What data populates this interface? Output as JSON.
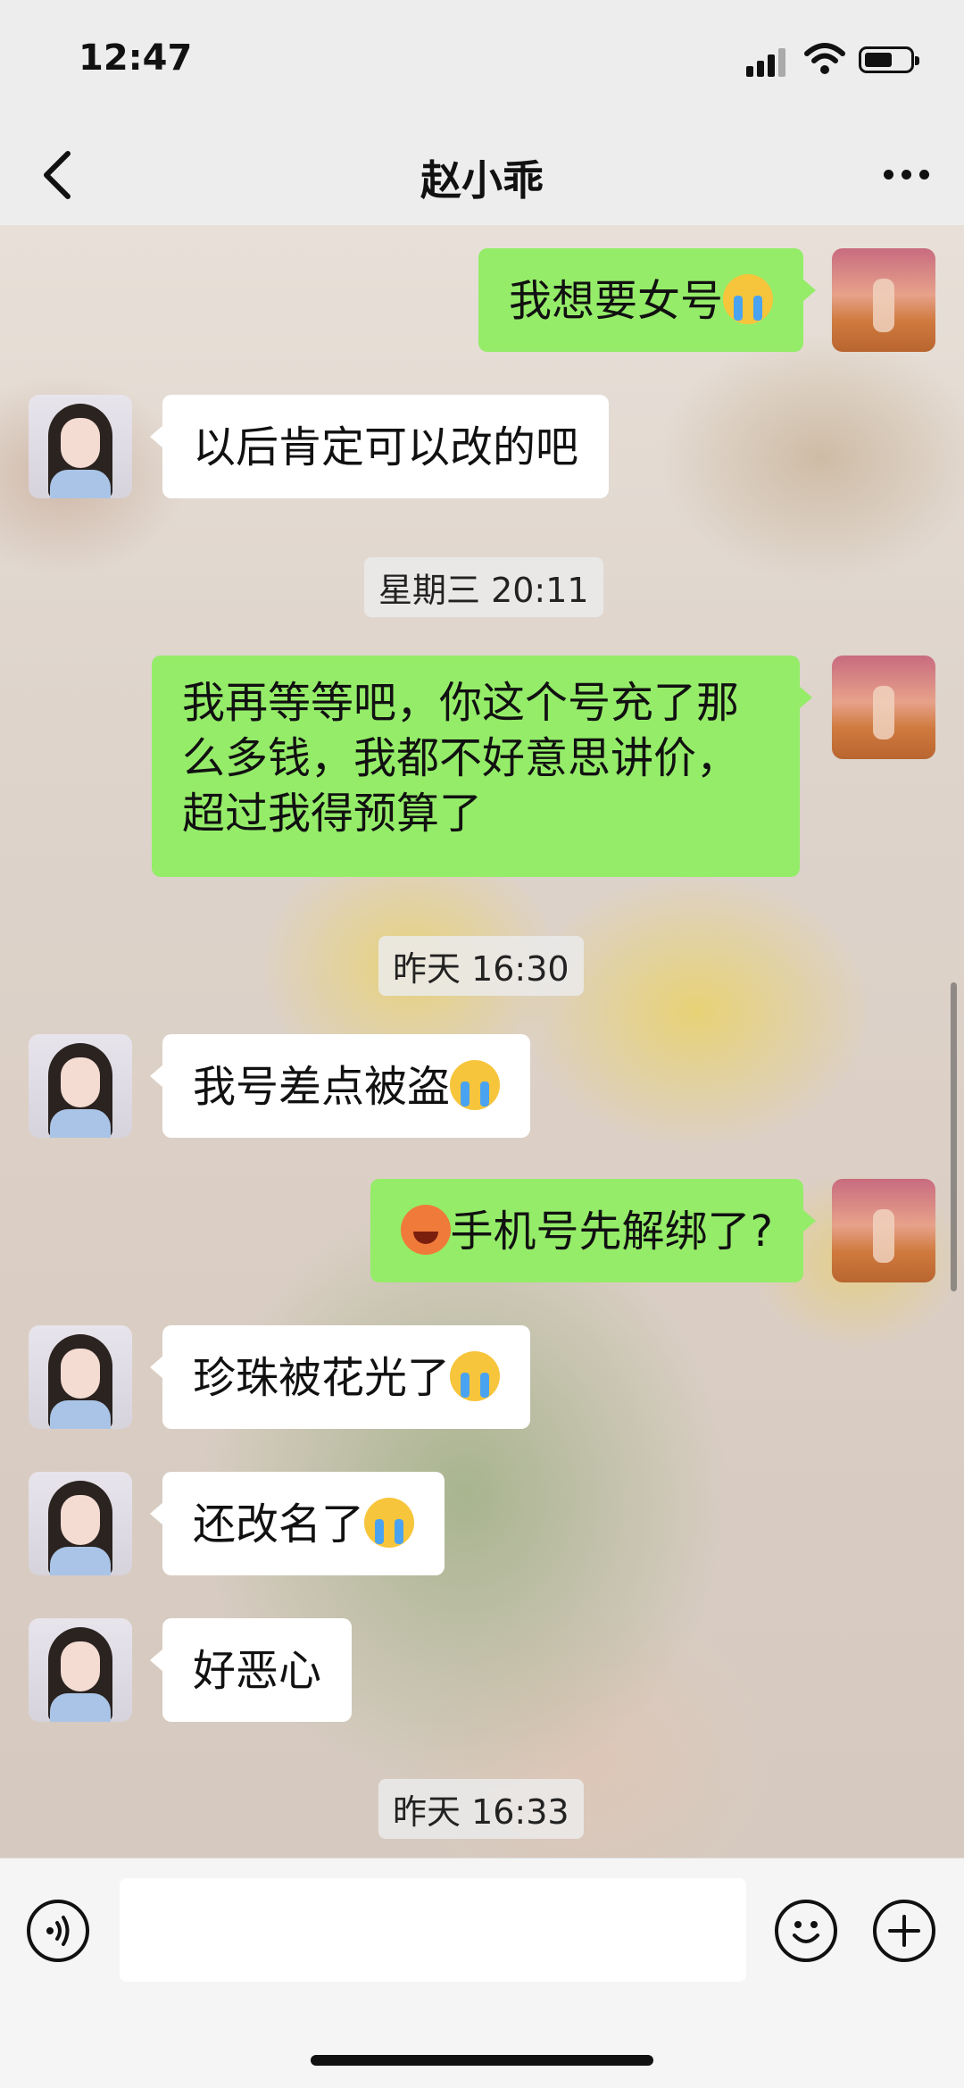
{
  "status_bar": {
    "time": "12:47"
  },
  "header": {
    "title": "赵小乖"
  },
  "messages": [
    {
      "from": "me",
      "text": "我想要女号",
      "emoji": "crying-emoji"
    },
    {
      "from": "other",
      "text": "以后肯定可以改的吧"
    },
    {
      "timestamp": "星期三 20:11"
    },
    {
      "from": "me",
      "lines": [
        "我再等等吧，你这个号充了那",
        "么多钱，我都不好意思讲价，",
        "超过我得预算了"
      ]
    },
    {
      "timestamp": "昨天 16:30"
    },
    {
      "from": "other",
      "text": "我号差点被盗",
      "emoji": "crying-emoji"
    },
    {
      "from": "me",
      "text": "手机号先解绑了?",
      "emoji_prefix": "angry-emoji"
    },
    {
      "from": "other",
      "text": "珍珠被花光了",
      "emoji": "crying-emoji"
    },
    {
      "from": "other",
      "text": "还改名了",
      "emoji": "crying-emoji"
    },
    {
      "from": "other",
      "text": "好恶心"
    },
    {
      "timestamp": "昨天 16:33"
    }
  ],
  "colors": {
    "my_bubble": "#95ec69",
    "their_bubble": "#ffffff",
    "bar_bg": "#ededed"
  },
  "input_bar": {
    "value": ""
  }
}
